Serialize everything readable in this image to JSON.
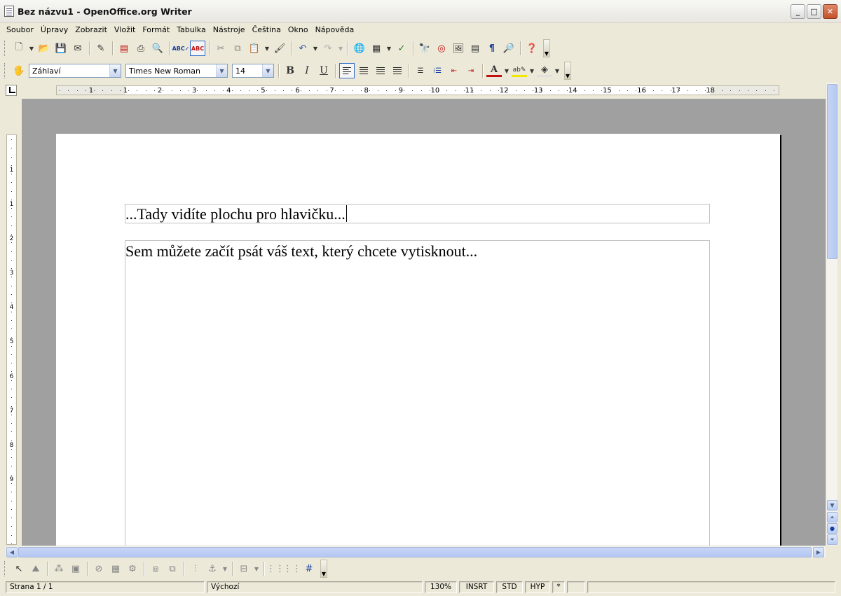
{
  "window": {
    "title": "Bez názvu1 - OpenOffice.org Writer"
  },
  "menu": [
    "Soubor",
    "Úpravy",
    "Zobrazit",
    "Vložit",
    "Formát",
    "Tabulka",
    "Nástroje",
    "Čeština",
    "Okno",
    "Nápověda"
  ],
  "formatting": {
    "paragraph_style": "Záhlaví",
    "font_name": "Times New Roman",
    "font_size": "14",
    "bold_label": "B",
    "italic_label": "I",
    "underline_label": "U"
  },
  "ruler": {
    "h_labels": [
      "1",
      "1",
      "2",
      "3",
      "4",
      "5",
      "6",
      "7",
      "8",
      "9",
      "10",
      "11",
      "12",
      "13",
      "14",
      "15",
      "16",
      "17",
      "18"
    ],
    "v_labels": [
      "1",
      "1",
      "2",
      "3",
      "4",
      "5",
      "6",
      "7",
      "8",
      "9"
    ]
  },
  "document": {
    "header_text": "...Tady vidíte plochu pro hlavičku...",
    "body_text": "Sem můžete začít psát váš text, který chcete vytisknout..."
  },
  "status": {
    "page": "Strana 1 / 1",
    "page_style": "Výchozí",
    "zoom": "130%",
    "insert_mode": "INSRT",
    "selection_mode": "STD",
    "hyperlink_mode": "HYP",
    "modified": "*"
  }
}
